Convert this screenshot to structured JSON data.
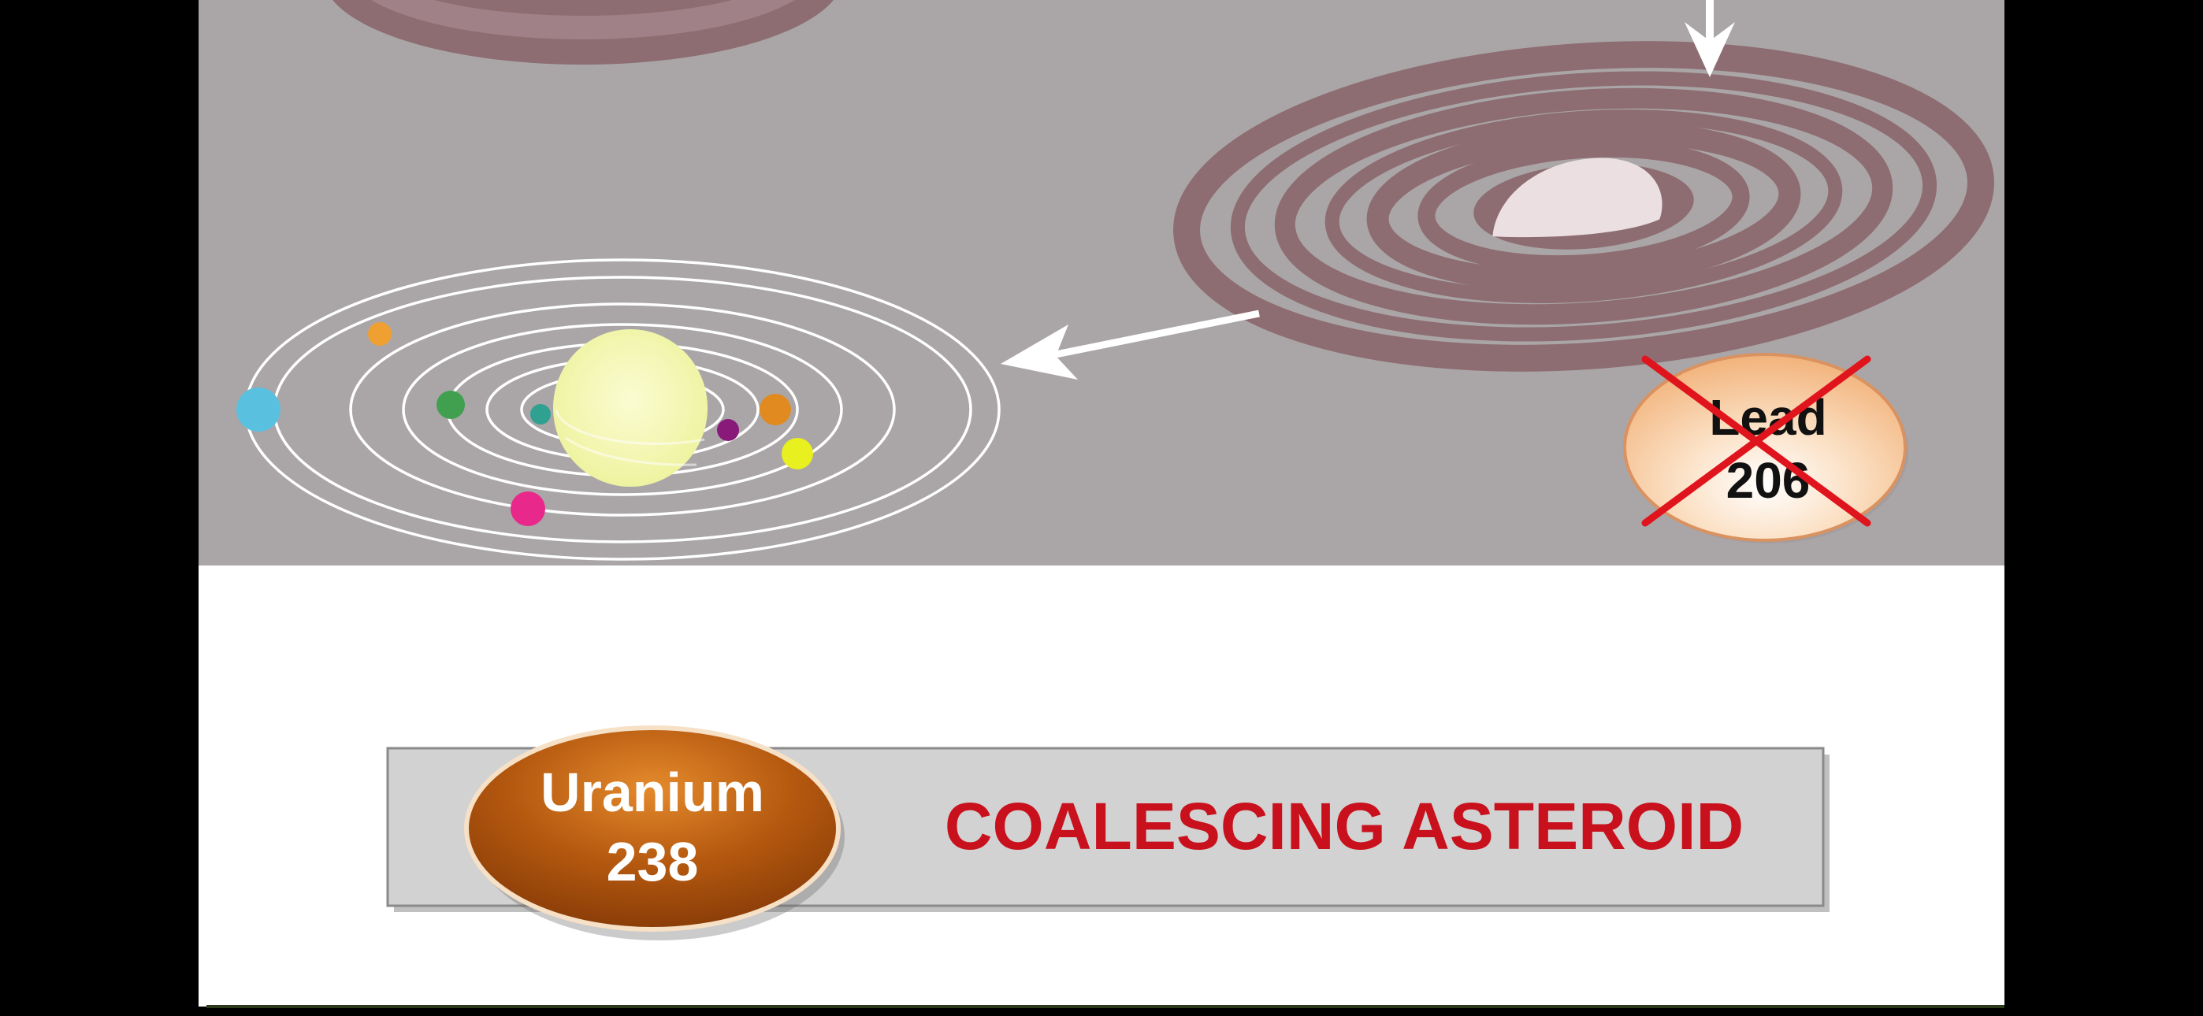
{
  "slide": {
    "lead_badge": {
      "line1": "Lead",
      "line2": "206",
      "status": "crossed-out"
    },
    "uranium_badge": {
      "line1": "Uranium",
      "line2": "238"
    },
    "caption": "COALESCING ASTEROID"
  },
  "colors": {
    "letterbox": "#000000",
    "upper_panel": "#aaa6a8",
    "lower_panel": "#ffffff",
    "nebula": "#8d6d71",
    "nebula_core": "#ecdfe1",
    "orbit": "#ffffff",
    "sun": "#f4f6b4",
    "caption_text": "#c8111c",
    "caption_bar": "#d2d2d2",
    "uranium_fill": "#a9500f",
    "lead_fill": "#f5c497",
    "cross": "#e0141c",
    "planets": [
      "#5ac0e0",
      "#f0a030",
      "#40a050",
      "#30a090",
      "#8a1a7a",
      "#e08a20",
      "#e8f020",
      "#e8288a"
    ]
  },
  "icons": [
    "arrow-down-icon",
    "arrow-left-icon",
    "cross-mark-icon"
  ]
}
